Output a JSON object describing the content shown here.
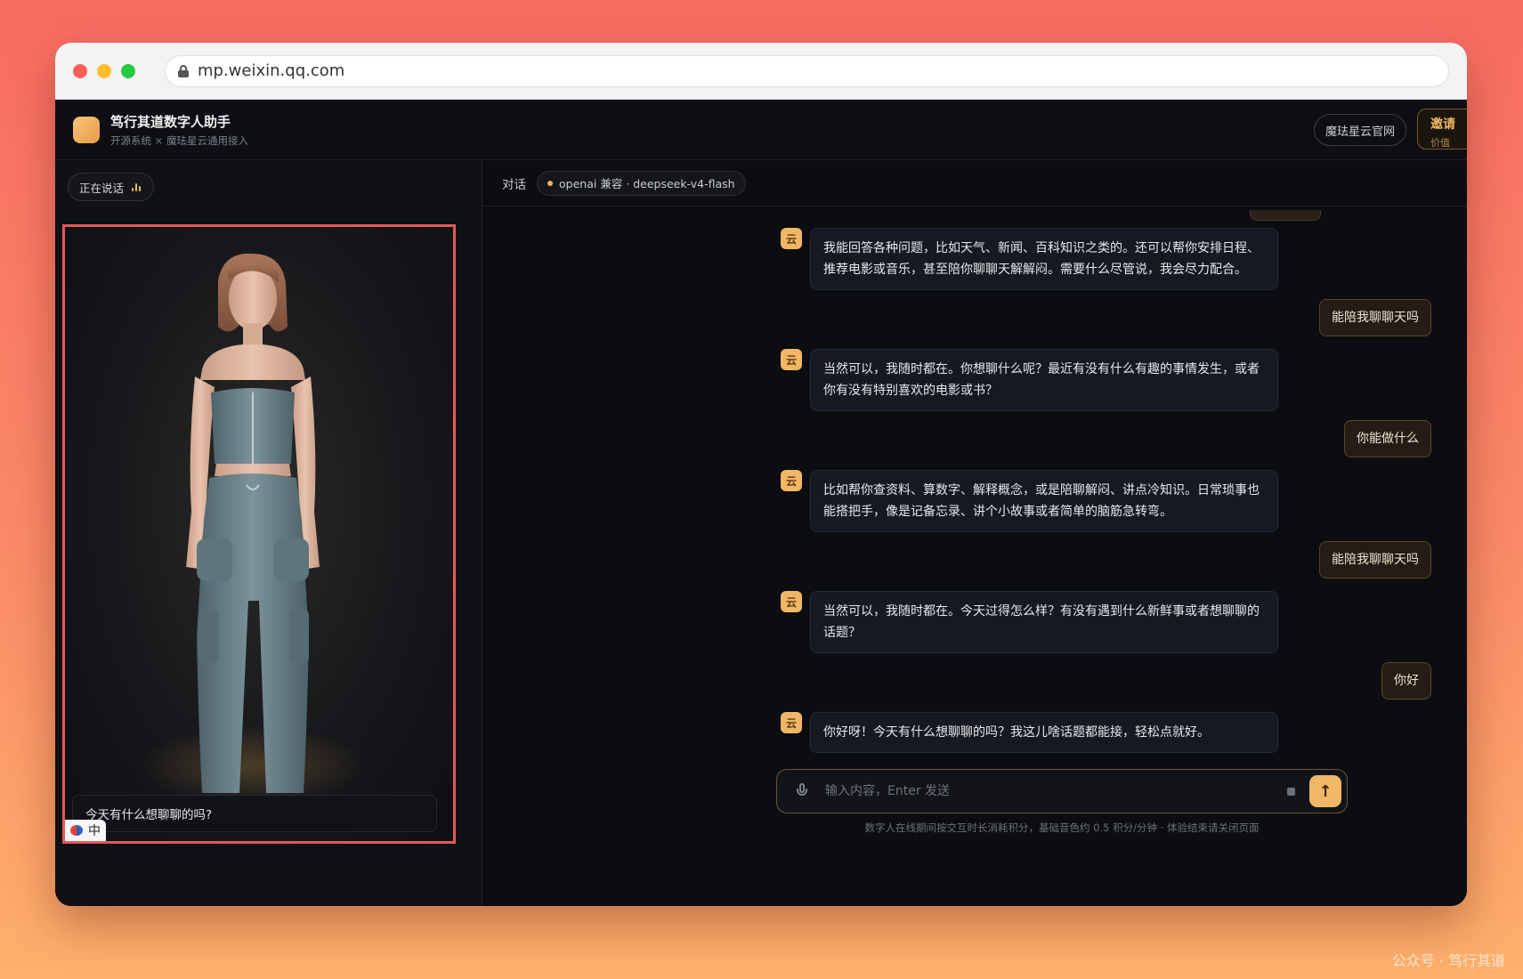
{
  "browser": {
    "url": "mp.weixin.qq.com"
  },
  "header": {
    "title": "笃行其道数字人助手",
    "subtitle": "开源系统 × 魔珐星云通用接入",
    "official_site": "魔珐星云官网",
    "invite_line1": "邀请",
    "invite_line2": "价值"
  },
  "left": {
    "status": "正在说话",
    "caption": "今天有什么想聊聊的吗?",
    "ime": "中"
  },
  "chat": {
    "tab": "对话",
    "model": "openai 兼容 · deepseek-v4-flash",
    "ai_avatar_char": "云",
    "messages": [
      {
        "role": "ai",
        "text": "我能回答各种问题，比如天气、新闻、百科知识之类的。还可以帮你安排日程、推荐电影或音乐，甚至陪你聊聊天解解闷。需要什么尽管说，我会尽力配合。"
      },
      {
        "role": "user",
        "text": "能陪我聊聊天吗"
      },
      {
        "role": "ai",
        "text": "当然可以，我随时都在。你想聊什么呢？最近有没有什么有趣的事情发生，或者你有没有特别喜欢的电影或书？"
      },
      {
        "role": "user",
        "text": "你能做什么"
      },
      {
        "role": "ai",
        "text": "比如帮你查资料、算数字、解释概念，或是陪聊解闷、讲点冷知识。日常琐事也能搭把手，像是记备忘录、讲个小故事或者简单的脑筋急转弯。"
      },
      {
        "role": "user",
        "text": "能陪我聊聊天吗"
      },
      {
        "role": "ai",
        "text": "当然可以，我随时都在。今天过得怎么样？有没有遇到什么新鲜事或者想聊聊的话题？"
      },
      {
        "role": "user",
        "text": "你好"
      },
      {
        "role": "ai",
        "text": "你好呀！今天有什么想聊聊的吗？我这儿啥话题都能接，轻松点就好。"
      }
    ],
    "input_placeholder": "输入内容，Enter 发送",
    "input_value": "",
    "send_glyph": "↑",
    "footnote": "数字人在线期间按交互时长消耗积分，基础音色约 0.5 积分/分钟 · 体验结束请关闭页面"
  },
  "watermark": "公众号 · 笃行其道",
  "colors": {
    "accent": "#f1b766",
    "stage_border": "#e6585b"
  }
}
